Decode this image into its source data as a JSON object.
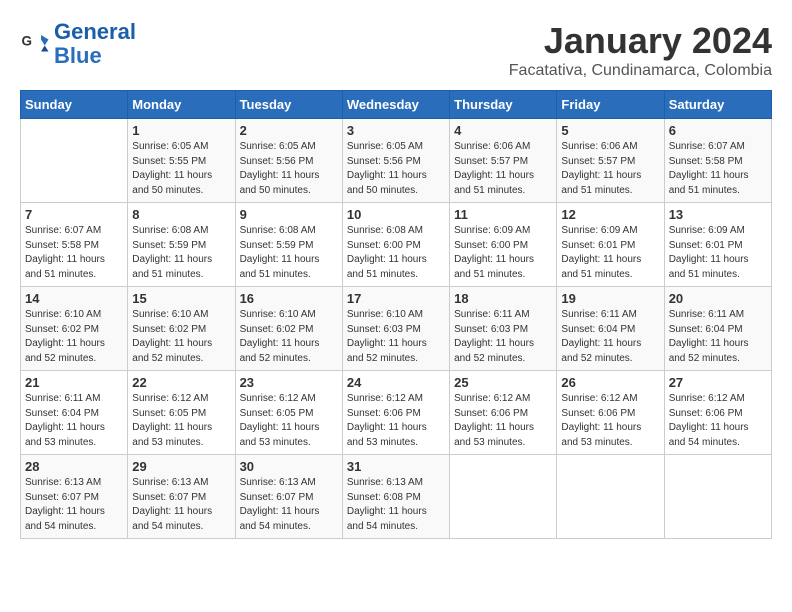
{
  "header": {
    "logo_line1": "General",
    "logo_line2": "Blue",
    "month": "January 2024",
    "location": "Facatativa, Cundinamarca, Colombia"
  },
  "days_of_week": [
    "Sunday",
    "Monday",
    "Tuesday",
    "Wednesday",
    "Thursday",
    "Friday",
    "Saturday"
  ],
  "weeks": [
    [
      {
        "day": "",
        "info": ""
      },
      {
        "day": "1",
        "info": "Sunrise: 6:05 AM\nSunset: 5:55 PM\nDaylight: 11 hours\nand 50 minutes."
      },
      {
        "day": "2",
        "info": "Sunrise: 6:05 AM\nSunset: 5:56 PM\nDaylight: 11 hours\nand 50 minutes."
      },
      {
        "day": "3",
        "info": "Sunrise: 6:05 AM\nSunset: 5:56 PM\nDaylight: 11 hours\nand 50 minutes."
      },
      {
        "day": "4",
        "info": "Sunrise: 6:06 AM\nSunset: 5:57 PM\nDaylight: 11 hours\nand 51 minutes."
      },
      {
        "day": "5",
        "info": "Sunrise: 6:06 AM\nSunset: 5:57 PM\nDaylight: 11 hours\nand 51 minutes."
      },
      {
        "day": "6",
        "info": "Sunrise: 6:07 AM\nSunset: 5:58 PM\nDaylight: 11 hours\nand 51 minutes."
      }
    ],
    [
      {
        "day": "7",
        "info": "Sunrise: 6:07 AM\nSunset: 5:58 PM\nDaylight: 11 hours\nand 51 minutes."
      },
      {
        "day": "8",
        "info": "Sunrise: 6:08 AM\nSunset: 5:59 PM\nDaylight: 11 hours\nand 51 minutes."
      },
      {
        "day": "9",
        "info": "Sunrise: 6:08 AM\nSunset: 5:59 PM\nDaylight: 11 hours\nand 51 minutes."
      },
      {
        "day": "10",
        "info": "Sunrise: 6:08 AM\nSunset: 6:00 PM\nDaylight: 11 hours\nand 51 minutes."
      },
      {
        "day": "11",
        "info": "Sunrise: 6:09 AM\nSunset: 6:00 PM\nDaylight: 11 hours\nand 51 minutes."
      },
      {
        "day": "12",
        "info": "Sunrise: 6:09 AM\nSunset: 6:01 PM\nDaylight: 11 hours\nand 51 minutes."
      },
      {
        "day": "13",
        "info": "Sunrise: 6:09 AM\nSunset: 6:01 PM\nDaylight: 11 hours\nand 51 minutes."
      }
    ],
    [
      {
        "day": "14",
        "info": "Sunrise: 6:10 AM\nSunset: 6:02 PM\nDaylight: 11 hours\nand 52 minutes."
      },
      {
        "day": "15",
        "info": "Sunrise: 6:10 AM\nSunset: 6:02 PM\nDaylight: 11 hours\nand 52 minutes."
      },
      {
        "day": "16",
        "info": "Sunrise: 6:10 AM\nSunset: 6:02 PM\nDaylight: 11 hours\nand 52 minutes."
      },
      {
        "day": "17",
        "info": "Sunrise: 6:10 AM\nSunset: 6:03 PM\nDaylight: 11 hours\nand 52 minutes."
      },
      {
        "day": "18",
        "info": "Sunrise: 6:11 AM\nSunset: 6:03 PM\nDaylight: 11 hours\nand 52 minutes."
      },
      {
        "day": "19",
        "info": "Sunrise: 6:11 AM\nSunset: 6:04 PM\nDaylight: 11 hours\nand 52 minutes."
      },
      {
        "day": "20",
        "info": "Sunrise: 6:11 AM\nSunset: 6:04 PM\nDaylight: 11 hours\nand 52 minutes."
      }
    ],
    [
      {
        "day": "21",
        "info": "Sunrise: 6:11 AM\nSunset: 6:04 PM\nDaylight: 11 hours\nand 53 minutes."
      },
      {
        "day": "22",
        "info": "Sunrise: 6:12 AM\nSunset: 6:05 PM\nDaylight: 11 hours\nand 53 minutes."
      },
      {
        "day": "23",
        "info": "Sunrise: 6:12 AM\nSunset: 6:05 PM\nDaylight: 11 hours\nand 53 minutes."
      },
      {
        "day": "24",
        "info": "Sunrise: 6:12 AM\nSunset: 6:06 PM\nDaylight: 11 hours\nand 53 minutes."
      },
      {
        "day": "25",
        "info": "Sunrise: 6:12 AM\nSunset: 6:06 PM\nDaylight: 11 hours\nand 53 minutes."
      },
      {
        "day": "26",
        "info": "Sunrise: 6:12 AM\nSunset: 6:06 PM\nDaylight: 11 hours\nand 53 minutes."
      },
      {
        "day": "27",
        "info": "Sunrise: 6:12 AM\nSunset: 6:06 PM\nDaylight: 11 hours\nand 54 minutes."
      }
    ],
    [
      {
        "day": "28",
        "info": "Sunrise: 6:13 AM\nSunset: 6:07 PM\nDaylight: 11 hours\nand 54 minutes."
      },
      {
        "day": "29",
        "info": "Sunrise: 6:13 AM\nSunset: 6:07 PM\nDaylight: 11 hours\nand 54 minutes."
      },
      {
        "day": "30",
        "info": "Sunrise: 6:13 AM\nSunset: 6:07 PM\nDaylight: 11 hours\nand 54 minutes."
      },
      {
        "day": "31",
        "info": "Sunrise: 6:13 AM\nSunset: 6:08 PM\nDaylight: 11 hours\nand 54 minutes."
      },
      {
        "day": "",
        "info": ""
      },
      {
        "day": "",
        "info": ""
      },
      {
        "day": "",
        "info": ""
      }
    ]
  ]
}
